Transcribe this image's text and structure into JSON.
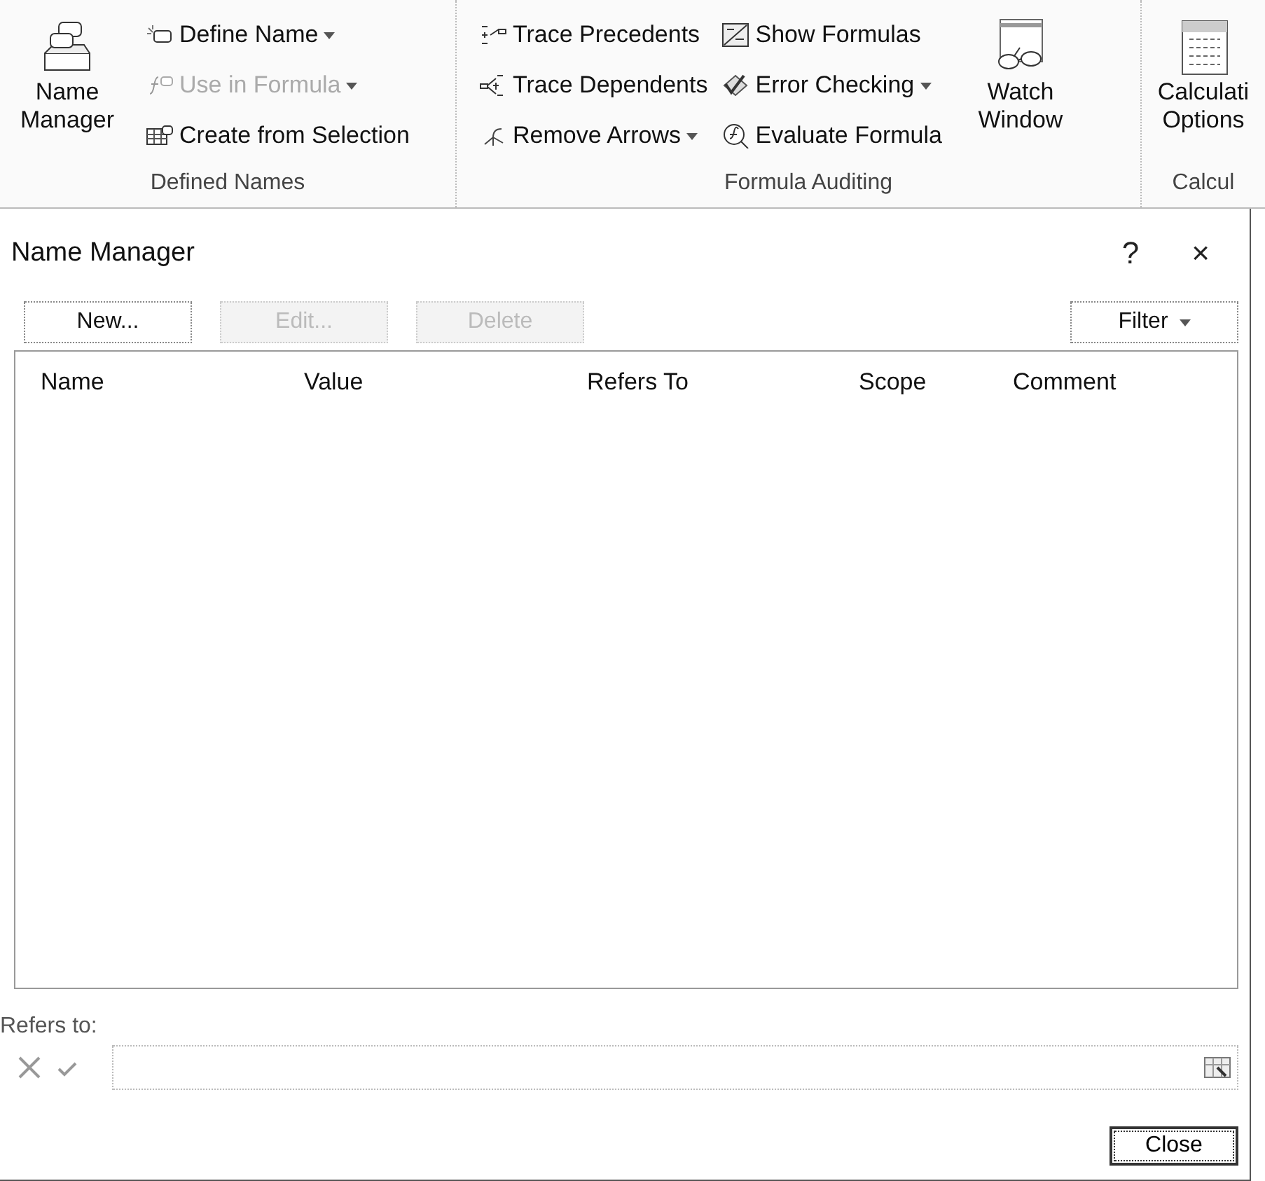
{
  "ribbon": {
    "groups": [
      {
        "label": "Defined Names",
        "items": [
          {
            "kind": "large",
            "label": "Name Manager",
            "disabled": false
          },
          {
            "kind": "stack",
            "entries": [
              {
                "label": "Define Name",
                "dropdown": true,
                "disabled": false
              },
              {
                "label": "Use in Formula",
                "dropdown": true,
                "disabled": true
              },
              {
                "label": "Create from Selection",
                "dropdown": false,
                "disabled": false
              }
            ]
          }
        ]
      },
      {
        "label": "Formula Auditing",
        "items": [
          {
            "kind": "stack",
            "entries": [
              {
                "label": "Trace Precedents",
                "dropdown": false,
                "disabled": false
              },
              {
                "label": "Trace Dependents",
                "dropdown": false,
                "disabled": false
              },
              {
                "label": "Remove Arrows",
                "dropdown": true,
                "disabled": false
              }
            ]
          },
          {
            "kind": "stack",
            "entries": [
              {
                "label": "Show Formulas",
                "dropdown": false,
                "disabled": false
              },
              {
                "label": "Error Checking",
                "dropdown": true,
                "disabled": false
              },
              {
                "label": "Evaluate Formula",
                "dropdown": false,
                "disabled": false
              }
            ]
          },
          {
            "kind": "large",
            "label": "Watch Window",
            "disabled": false
          }
        ]
      },
      {
        "label": "Calcul",
        "items": [
          {
            "kind": "large",
            "label": "Calculati Options",
            "disabled": false
          }
        ]
      }
    ]
  },
  "dialog": {
    "title": "Name Manager",
    "help": "?",
    "close": "×",
    "buttons": [
      {
        "label": "New...",
        "disabled": false
      },
      {
        "label": "Edit...",
        "disabled": true
      },
      {
        "label": "Delete",
        "disabled": true
      }
    ],
    "filter": {
      "label": "Filter",
      "dropdown": true
    },
    "columns": [
      "Name",
      "Value",
      "Refers To",
      "Scope",
      "Comment"
    ],
    "refers_to": {
      "label": "Refers to:"
    },
    "close_button": "Close"
  }
}
